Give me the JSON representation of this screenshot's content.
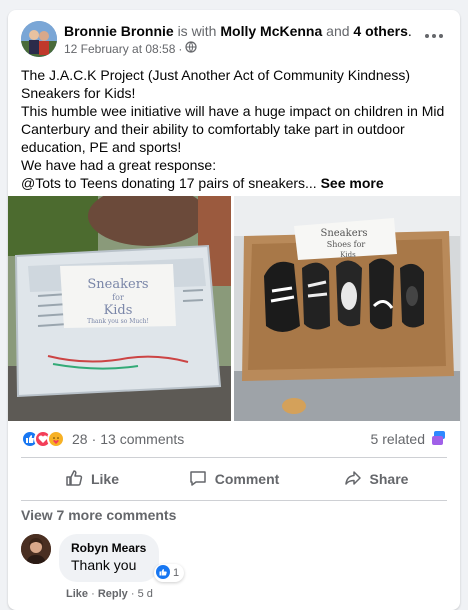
{
  "post": {
    "author": "Bronnie Bronnie",
    "with_text": "is with",
    "tagged_person": "Molly McKenna",
    "and_text": "and",
    "others": "4 others",
    "period": ".",
    "timestamp": "12 February at 08:58",
    "audience_icon": "globe-icon",
    "text_lines": [
      "The J.A.C.K Project (Just Another Act of Community Kindness)",
      "Sneakers for Kids!",
      "This humble wee initiative will have a huge impact on children in Mid Canterbury and their ability to comfortably take part in outdoor education, PE and sports!",
      "We have had a great response:",
      "@Tots to Teens donating 17 pairs of sneakers..."
    ],
    "see_more": "See more"
  },
  "photos": {
    "left_sign_lines": [
      "Sneakers",
      "for",
      "Kids",
      "Thank you so Much!"
    ],
    "right_sign_lines": [
      "Sneakers",
      "Shoes for",
      "Kids"
    ]
  },
  "reactions": {
    "icons": [
      "like-icon",
      "love-icon",
      "care-icon"
    ],
    "count": "28",
    "separator": "·",
    "comments": "13 comments",
    "related": "5 related"
  },
  "actions": {
    "like": "Like",
    "comment": "Comment",
    "share": "Share"
  },
  "comments": {
    "view_more": "View 7 more comments",
    "items": [
      {
        "name": "Robyn Mears",
        "text": "Thank you",
        "reaction_count": "1",
        "like_label": "Like",
        "sep1": "·",
        "reply_label": "Reply",
        "sep2": "·",
        "age": "5 d"
      }
    ]
  },
  "colors": {
    "like_blue": "#1877f2",
    "love_red": "#f33e58",
    "care_yellow": "#f7b125",
    "muted_text": "#65676b"
  }
}
